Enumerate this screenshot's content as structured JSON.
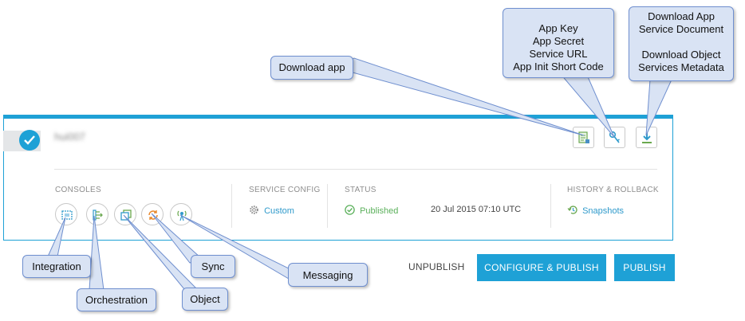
{
  "app": {
    "name": "hui007",
    "selected": true
  },
  "header_actions": [
    {
      "id": "download-app",
      "icon": "download-app-icon"
    },
    {
      "id": "keys",
      "icon": "key-icon"
    },
    {
      "id": "download-docs",
      "icon": "download-arrow-icon"
    }
  ],
  "consoles": {
    "label": "CONSOLES",
    "items": [
      {
        "id": "integration",
        "icon": "integration-icon"
      },
      {
        "id": "orchestration",
        "icon": "orchestration-icon"
      },
      {
        "id": "object",
        "icon": "object-icon"
      },
      {
        "id": "sync",
        "icon": "sync-icon"
      },
      {
        "id": "messaging",
        "icon": "messaging-icon"
      }
    ]
  },
  "service_config": {
    "label": "SERVICE CONFIG",
    "value": "Custom",
    "icon": "gear-icon"
  },
  "status": {
    "label": "STATUS",
    "value": "Published",
    "date": "20 Jul 2015 07:10 UTC",
    "icon": "check-circle-icon"
  },
  "history": {
    "label": "HISTORY & ROLLBACK",
    "value": "Snapshots",
    "icon": "history-icon"
  },
  "actions": {
    "unpublish": "UNPUBLISH",
    "configure_publish": "CONFIGURE & PUBLISH",
    "publish": "PUBLISH"
  },
  "callouts": {
    "download_app": "Download app",
    "keys": [
      "App Key",
      "App Secret",
      "Service URL",
      "App Init Short Code"
    ],
    "docs": [
      "Download App",
      "Service Document",
      "",
      "Download Object",
      "Services Metadata"
    ],
    "integration": "Integration",
    "orchestration": "Orchestration",
    "object": "Object",
    "sync": "Sync",
    "messaging": "Messaging"
  },
  "colors": {
    "accent": "#1ea1d6",
    "success": "#5bb05b",
    "callout_fill": "#d9e3f4",
    "callout_border": "#6f8fcf"
  }
}
